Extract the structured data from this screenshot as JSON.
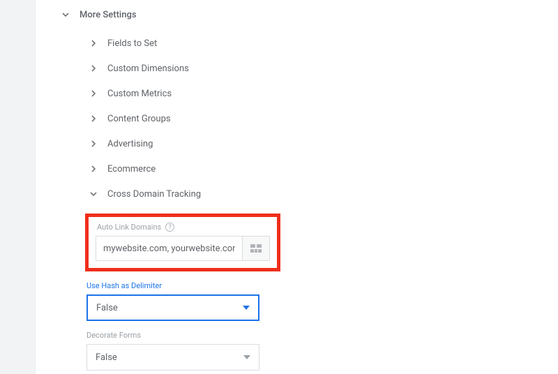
{
  "moreSettings": {
    "label": "More Settings",
    "items": [
      {
        "label": "Fields to Set"
      },
      {
        "label": "Custom Dimensions"
      },
      {
        "label": "Custom Metrics"
      },
      {
        "label": "Content Groups"
      },
      {
        "label": "Advertising"
      },
      {
        "label": "Ecommerce"
      }
    ],
    "crossDomain": {
      "label": "Cross Domain Tracking",
      "autoLink": {
        "label": "Auto Link Domains",
        "value": "mywebsite.com, yourwebsite.com"
      },
      "useHash": {
        "label": "Use Hash as Delimiter",
        "value": "False"
      },
      "decorateForms": {
        "label": "Decorate Forms",
        "value": "False"
      }
    }
  }
}
